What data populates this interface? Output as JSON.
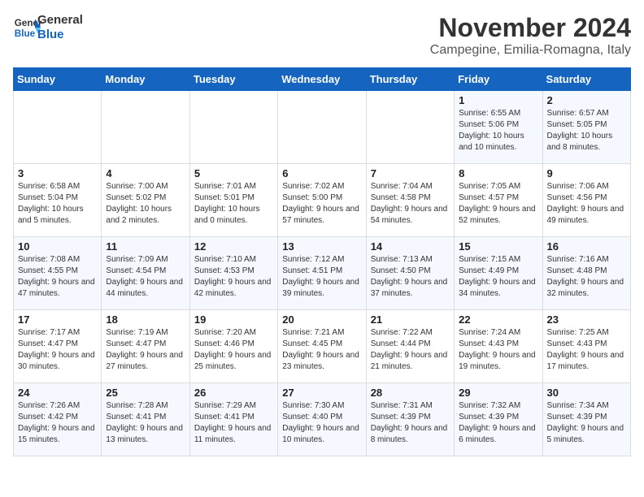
{
  "logo": {
    "line1": "General",
    "line2": "Blue"
  },
  "title": "November 2024",
  "location": "Campegine, Emilia-Romagna, Italy",
  "days_of_week": [
    "Sunday",
    "Monday",
    "Tuesday",
    "Wednesday",
    "Thursday",
    "Friday",
    "Saturday"
  ],
  "weeks": [
    [
      {
        "day": "",
        "info": ""
      },
      {
        "day": "",
        "info": ""
      },
      {
        "day": "",
        "info": ""
      },
      {
        "day": "",
        "info": ""
      },
      {
        "day": "",
        "info": ""
      },
      {
        "day": "1",
        "info": "Sunrise: 6:55 AM\nSunset: 5:06 PM\nDaylight: 10 hours and 10 minutes."
      },
      {
        "day": "2",
        "info": "Sunrise: 6:57 AM\nSunset: 5:05 PM\nDaylight: 10 hours and 8 minutes."
      }
    ],
    [
      {
        "day": "3",
        "info": "Sunrise: 6:58 AM\nSunset: 5:04 PM\nDaylight: 10 hours and 5 minutes."
      },
      {
        "day": "4",
        "info": "Sunrise: 7:00 AM\nSunset: 5:02 PM\nDaylight: 10 hours and 2 minutes."
      },
      {
        "day": "5",
        "info": "Sunrise: 7:01 AM\nSunset: 5:01 PM\nDaylight: 10 hours and 0 minutes."
      },
      {
        "day": "6",
        "info": "Sunrise: 7:02 AM\nSunset: 5:00 PM\nDaylight: 9 hours and 57 minutes."
      },
      {
        "day": "7",
        "info": "Sunrise: 7:04 AM\nSunset: 4:58 PM\nDaylight: 9 hours and 54 minutes."
      },
      {
        "day": "8",
        "info": "Sunrise: 7:05 AM\nSunset: 4:57 PM\nDaylight: 9 hours and 52 minutes."
      },
      {
        "day": "9",
        "info": "Sunrise: 7:06 AM\nSunset: 4:56 PM\nDaylight: 9 hours and 49 minutes."
      }
    ],
    [
      {
        "day": "10",
        "info": "Sunrise: 7:08 AM\nSunset: 4:55 PM\nDaylight: 9 hours and 47 minutes."
      },
      {
        "day": "11",
        "info": "Sunrise: 7:09 AM\nSunset: 4:54 PM\nDaylight: 9 hours and 44 minutes."
      },
      {
        "day": "12",
        "info": "Sunrise: 7:10 AM\nSunset: 4:53 PM\nDaylight: 9 hours and 42 minutes."
      },
      {
        "day": "13",
        "info": "Sunrise: 7:12 AM\nSunset: 4:51 PM\nDaylight: 9 hours and 39 minutes."
      },
      {
        "day": "14",
        "info": "Sunrise: 7:13 AM\nSunset: 4:50 PM\nDaylight: 9 hours and 37 minutes."
      },
      {
        "day": "15",
        "info": "Sunrise: 7:15 AM\nSunset: 4:49 PM\nDaylight: 9 hours and 34 minutes."
      },
      {
        "day": "16",
        "info": "Sunrise: 7:16 AM\nSunset: 4:48 PM\nDaylight: 9 hours and 32 minutes."
      }
    ],
    [
      {
        "day": "17",
        "info": "Sunrise: 7:17 AM\nSunset: 4:47 PM\nDaylight: 9 hours and 30 minutes."
      },
      {
        "day": "18",
        "info": "Sunrise: 7:19 AM\nSunset: 4:47 PM\nDaylight: 9 hours and 27 minutes."
      },
      {
        "day": "19",
        "info": "Sunrise: 7:20 AM\nSunset: 4:46 PM\nDaylight: 9 hours and 25 minutes."
      },
      {
        "day": "20",
        "info": "Sunrise: 7:21 AM\nSunset: 4:45 PM\nDaylight: 9 hours and 23 minutes."
      },
      {
        "day": "21",
        "info": "Sunrise: 7:22 AM\nSunset: 4:44 PM\nDaylight: 9 hours and 21 minutes."
      },
      {
        "day": "22",
        "info": "Sunrise: 7:24 AM\nSunset: 4:43 PM\nDaylight: 9 hours and 19 minutes."
      },
      {
        "day": "23",
        "info": "Sunrise: 7:25 AM\nSunset: 4:43 PM\nDaylight: 9 hours and 17 minutes."
      }
    ],
    [
      {
        "day": "24",
        "info": "Sunrise: 7:26 AM\nSunset: 4:42 PM\nDaylight: 9 hours and 15 minutes."
      },
      {
        "day": "25",
        "info": "Sunrise: 7:28 AM\nSunset: 4:41 PM\nDaylight: 9 hours and 13 minutes."
      },
      {
        "day": "26",
        "info": "Sunrise: 7:29 AM\nSunset: 4:41 PM\nDaylight: 9 hours and 11 minutes."
      },
      {
        "day": "27",
        "info": "Sunrise: 7:30 AM\nSunset: 4:40 PM\nDaylight: 9 hours and 10 minutes."
      },
      {
        "day": "28",
        "info": "Sunrise: 7:31 AM\nSunset: 4:39 PM\nDaylight: 9 hours and 8 minutes."
      },
      {
        "day": "29",
        "info": "Sunrise: 7:32 AM\nSunset: 4:39 PM\nDaylight: 9 hours and 6 minutes."
      },
      {
        "day": "30",
        "info": "Sunrise: 7:34 AM\nSunset: 4:39 PM\nDaylight: 9 hours and 5 minutes."
      }
    ]
  ]
}
